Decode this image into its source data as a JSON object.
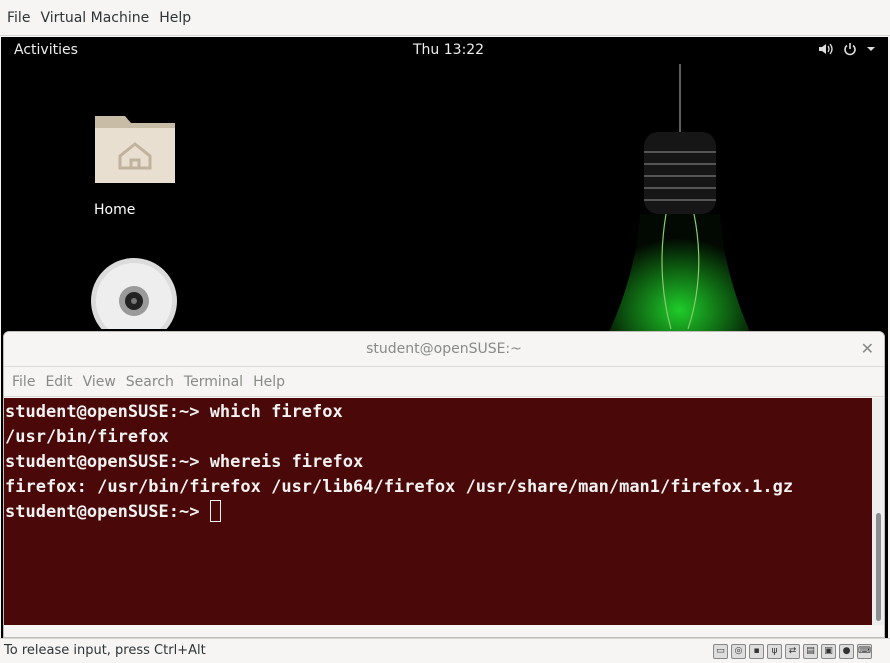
{
  "vm_menubar": {
    "items": [
      "File",
      "Virtual Machine",
      "Help"
    ]
  },
  "gnome_topbar": {
    "activities": "Activities",
    "clock": "Thu 13:22"
  },
  "desktop": {
    "home_label": "Home"
  },
  "terminal": {
    "title": "student@openSUSE:~",
    "menu": [
      "File",
      "Edit",
      "View",
      "Search",
      "Terminal",
      "Help"
    ],
    "lines": [
      "student@openSUSE:~> which firefox",
      "/usr/bin/firefox",
      "student@openSUSE:~> whereis firefox",
      "firefox: /usr/bin/firefox /usr/lib64/firefox /usr/share/man/man1/firefox.1.gz",
      "student@openSUSE:~> "
    ],
    "background_color": "#4a0808"
  },
  "status_bar": {
    "text": "To release input, press Ctrl+Alt"
  }
}
